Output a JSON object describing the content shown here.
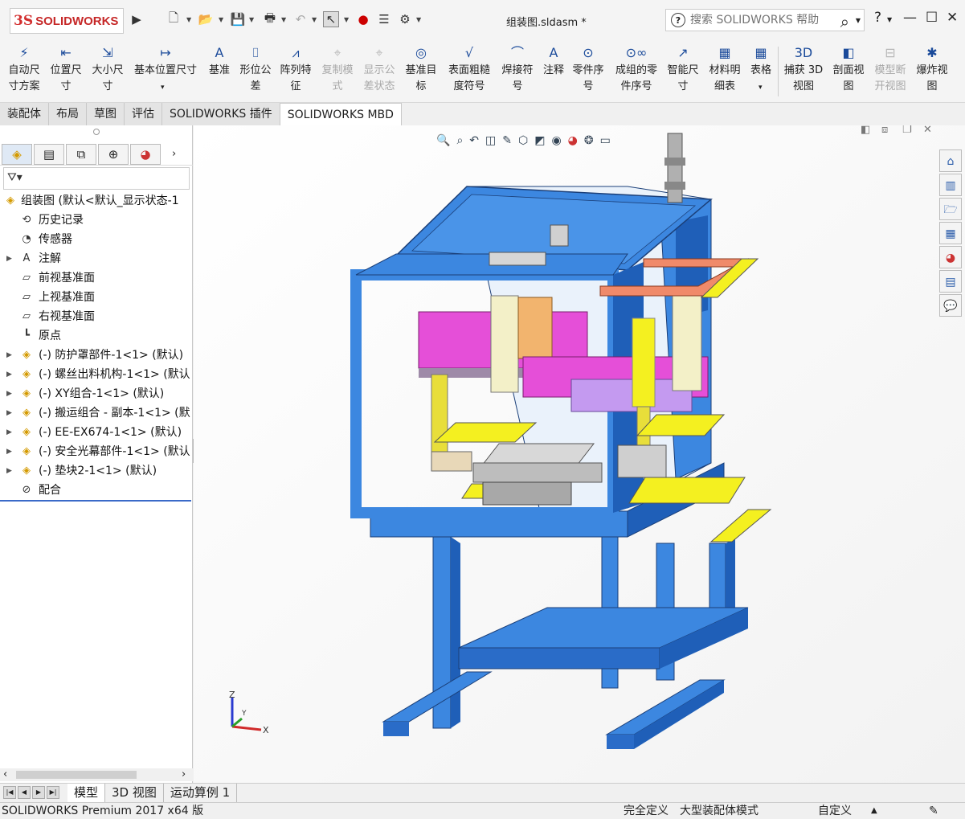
{
  "app": {
    "logo_ds": "3S",
    "logo_text": "SOLIDWORKS",
    "doc_title": "组装图.sldasm *"
  },
  "search": {
    "placeholder": "搜索 SOLIDWORKS 帮助"
  },
  "ribbon": {
    "commands": [
      {
        "label": "自动尺\n寸方案",
        "icon": "auto-dimension-icon",
        "enabled": true
      },
      {
        "label": "位置尺\n寸",
        "icon": "location-dimension-icon",
        "enabled": true
      },
      {
        "label": "大小尺\n寸",
        "icon": "size-dimension-icon",
        "enabled": true
      },
      {
        "label": "基本位置尺寸",
        "icon": "basic-location-dimension-icon",
        "enabled": true
      },
      {
        "label": "基准",
        "icon": "datum-icon",
        "enabled": true
      },
      {
        "label": "形位公\n差",
        "icon": "geometric-tolerance-icon",
        "enabled": true
      },
      {
        "label": "阵列特\n征",
        "icon": "pattern-feature-icon",
        "enabled": true
      },
      {
        "label": "复制模\n式",
        "icon": "copy-scheme-icon",
        "enabled": false
      },
      {
        "label": "显示公\n差状态",
        "icon": "show-tolerance-status-icon",
        "enabled": false
      },
      {
        "label": "基准目\n标",
        "icon": "datum-target-icon",
        "enabled": true
      },
      {
        "label": "表面粗糙\n度符号",
        "icon": "surface-finish-icon",
        "enabled": true
      },
      {
        "label": "焊接符\n号",
        "icon": "weld-symbol-icon",
        "enabled": true
      },
      {
        "label": "注释",
        "icon": "note-icon",
        "enabled": true
      },
      {
        "label": "零件序\n号",
        "icon": "balloon-icon",
        "enabled": true
      },
      {
        "label": "成组的零\n件序号",
        "icon": "stacked-balloon-icon",
        "enabled": true
      },
      {
        "label": "智能尺\n寸",
        "icon": "smart-dimension-icon",
        "enabled": true
      },
      {
        "label": "材料明\n细表",
        "icon": "bom-icon",
        "enabled": true
      },
      {
        "label": "表格",
        "icon": "table-icon",
        "enabled": true
      },
      {
        "label": "捕获 3D\n视图",
        "icon": "capture-3d-view-icon",
        "enabled": true
      },
      {
        "label": "剖面视\n图",
        "icon": "section-view-icon",
        "enabled": true
      },
      {
        "label": "模型断\n开视图",
        "icon": "model-break-view-icon",
        "enabled": false
      },
      {
        "label": "爆炸视\n图",
        "icon": "exploded-view-icon",
        "enabled": true
      }
    ]
  },
  "tabs": [
    "装配体",
    "布局",
    "草图",
    "评估",
    "SOLIDWORKS 插件",
    "SOLIDWORKS MBD"
  ],
  "active_tab": "SOLIDWORKS MBD",
  "tree": {
    "root": "组装图  (默认<默认_显示状态-1",
    "items": [
      {
        "label": "历史记录",
        "icon": "history-icon",
        "expandable": false
      },
      {
        "label": "传感器",
        "icon": "sensor-icon",
        "expandable": false
      },
      {
        "label": "注解",
        "icon": "annotation-icon",
        "expandable": true
      },
      {
        "label": "前视基准面",
        "icon": "plane-icon",
        "expandable": false
      },
      {
        "label": "上视基准面",
        "icon": "plane-icon",
        "expandable": false
      },
      {
        "label": "右视基准面",
        "icon": "plane-icon",
        "expandable": false
      },
      {
        "label": "原点",
        "icon": "origin-icon",
        "expandable": false
      },
      {
        "label": "(-) 防护罩部件-1<1> (默认)",
        "icon": "assembly-icon",
        "expandable": true
      },
      {
        "label": "(-) 螺丝出料机构-1<1> (默认",
        "icon": "assembly-icon",
        "expandable": true
      },
      {
        "label": "(-) XY组合-1<1> (默认)",
        "icon": "assembly-icon",
        "expandable": true
      },
      {
        "label": "(-) 搬运组合 - 副本-1<1> (默",
        "icon": "assembly-icon",
        "expandable": true
      },
      {
        "label": "(-) EE-EX674-1<1> (默认)",
        "icon": "assembly-icon",
        "expandable": true
      },
      {
        "label": "(-) 安全光幕部件-1<1> (默认",
        "icon": "assembly-icon",
        "expandable": true
      },
      {
        "label": "(-) 垫块2-1<1> (默认)",
        "icon": "assembly-icon",
        "expandable": true
      },
      {
        "label": "配合",
        "icon": "mates-icon",
        "expandable": false
      }
    ]
  },
  "bottom_tabs": [
    "模型",
    "3D 视图",
    "运动算例 1"
  ],
  "active_bottom_tab": "模型",
  "status": {
    "product": "SOLIDWORKS Premium 2017 x64 版",
    "definition": "完全定义",
    "mode": "大型装配体模式",
    "custom": "自定义"
  },
  "triad": {
    "x": "X",
    "y": "Y",
    "z": "Z"
  },
  "colors": {
    "frame_blue": "#3c87e0",
    "frame_dark": "#1f5fb8",
    "magenta": "#e54fd8",
    "yellow": "#f4f020",
    "beige": "#f3f0c8",
    "orange": "#f2b46e",
    "salmon": "#f08a6a",
    "violet": "#c49af0"
  }
}
